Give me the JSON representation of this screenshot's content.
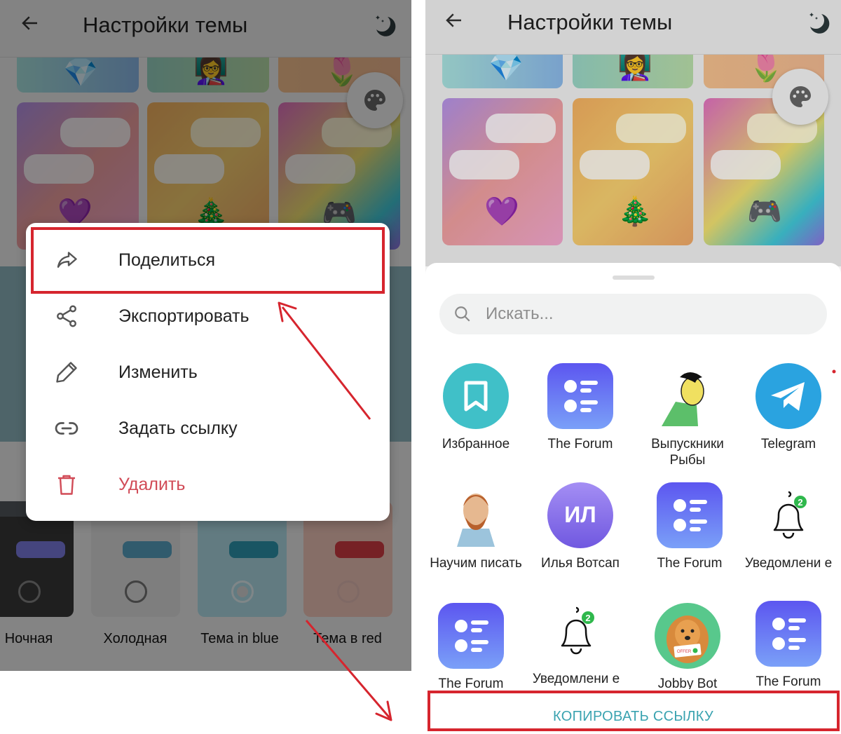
{
  "left_screen": {
    "appbar": {
      "back_icon": "arrow-left-icon",
      "title": "Настройки темы",
      "night_icon": "moon-stars-icon"
    },
    "palette_fab_icon": "palette-icon",
    "top_tiles": [
      {
        "emoji": "💎",
        "name": "diamond"
      },
      {
        "emoji": "👩‍🏫",
        "name": "teacher"
      },
      {
        "emoji": "🌷",
        "name": "tulip"
      }
    ],
    "main_tiles": [
      {
        "emoji": "💜",
        "name": "purple-heart"
      },
      {
        "emoji": "🎄",
        "name": "christmas-tree"
      },
      {
        "emoji": "🎮",
        "name": "gamepad"
      }
    ],
    "context_menu": {
      "items": [
        {
          "label": "Поделиться",
          "icon": "share-arrow-icon",
          "highlighted": true
        },
        {
          "label": "Экспортировать",
          "icon": "share-nodes-icon"
        },
        {
          "label": "Изменить",
          "icon": "pencil-icon"
        },
        {
          "label": "Задать ссылку",
          "icon": "link-icon"
        },
        {
          "label": "Удалить",
          "icon": "trash-icon",
          "danger": true
        }
      ]
    },
    "color_themes": [
      {
        "label": "Ночная",
        "selected": false
      },
      {
        "label": "Холодная",
        "selected": false
      },
      {
        "label": "Тема in blue",
        "selected": true
      },
      {
        "label": "Тема в red",
        "selected": false
      }
    ]
  },
  "right_screen": {
    "appbar": {
      "back_icon": "arrow-left-icon",
      "title": "Настройки темы",
      "night_icon": "moon-stars-icon"
    },
    "share_sheet": {
      "search_placeholder": "Искать...",
      "contacts": [
        {
          "name": "Избранное",
          "avatar": "bookmark-icon"
        },
        {
          "name": "The Forum",
          "avatar": "forum-list-icon"
        },
        {
          "name": "Выпускники Рыбы",
          "avatar": "cartoon-man-avatar"
        },
        {
          "name": "Telegram",
          "avatar": "telegram-plane-icon"
        },
        {
          "name": "Научим писать",
          "avatar": "van-gogh-avatar"
        },
        {
          "name": "Илья Вотсап",
          "avatar": "initials-avatar",
          "initials": "ИЛ"
        },
        {
          "name": "The Forum",
          "avatar": "forum-list-icon"
        },
        {
          "name": "Уведомлени е",
          "avatar": "bell-icon",
          "badge": "2"
        },
        {
          "name": "The Forum",
          "avatar": "forum-list-icon"
        },
        {
          "name": "Уведомлени е",
          "avatar": "bell-icon",
          "badge": "2"
        },
        {
          "name": "Jobby Bot",
          "avatar": "dog-avatar",
          "offer_text": "OFFER"
        },
        {
          "name": "The Forum",
          "avatar": "forum-list-icon"
        }
      ],
      "copy_link_label": "КОПИРОВАТЬ ССЫЛКУ"
    }
  },
  "colors": {
    "highlight_red": "#d6252e",
    "danger": "#d14b57",
    "accent_teal": "#3aa3b0",
    "telegram_blue": "#2aa3e0",
    "forum_purple": "#5b5ff0",
    "bookmark_teal": "#40c0c8"
  }
}
